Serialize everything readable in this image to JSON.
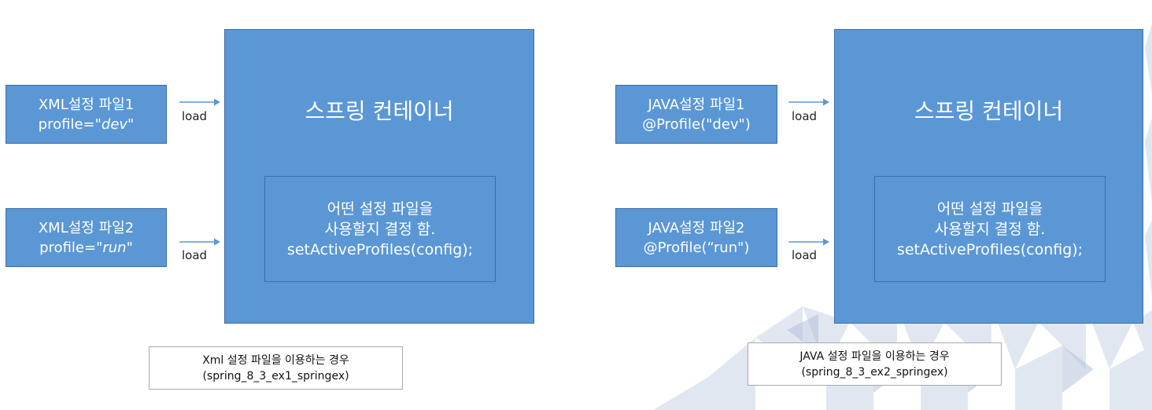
{
  "left": {
    "file1": {
      "line1": "XML설정 파일1",
      "prefix": "profile=",
      "value": "\"dev\""
    },
    "file2": {
      "line1": "XML설정 파일2",
      "prefix": "profile=",
      "value": "\"run\""
    },
    "load1": "load",
    "load2": "load",
    "container_title": "스프링 컨테이너",
    "inner": {
      "line1": "어떤 설정 파일을",
      "line2": "사용할지 결정 함.",
      "line3": "setActiveProfiles(config);"
    },
    "caption": {
      "line1": "Xml 설정 파일을 이용하는 경우",
      "line2": "(spring_8_3_ex1_springex)"
    }
  },
  "right": {
    "file1": {
      "line1": "JAVA설정 파일1",
      "line2": "@Profile(\"dev\")"
    },
    "file2": {
      "line1": "JAVA설정 파일2",
      "line2": "@Profile(“run\")"
    },
    "load1": "load",
    "load2": "load",
    "container_title": "스프링 컨테이너",
    "inner": {
      "line1": "어떤 설정 파일을",
      "line2": "사용할지 결정 함.",
      "line3": "setActiveProfiles(config);"
    },
    "caption": {
      "line1": "JAVA 설정 파일을 이용하는 경우",
      "line2": "(spring_8_3_ex2_springex)"
    }
  },
  "colors": {
    "box_fill": "#5b97d5",
    "box_border": "#3d6ea3",
    "arrow": "#5b97d5"
  }
}
